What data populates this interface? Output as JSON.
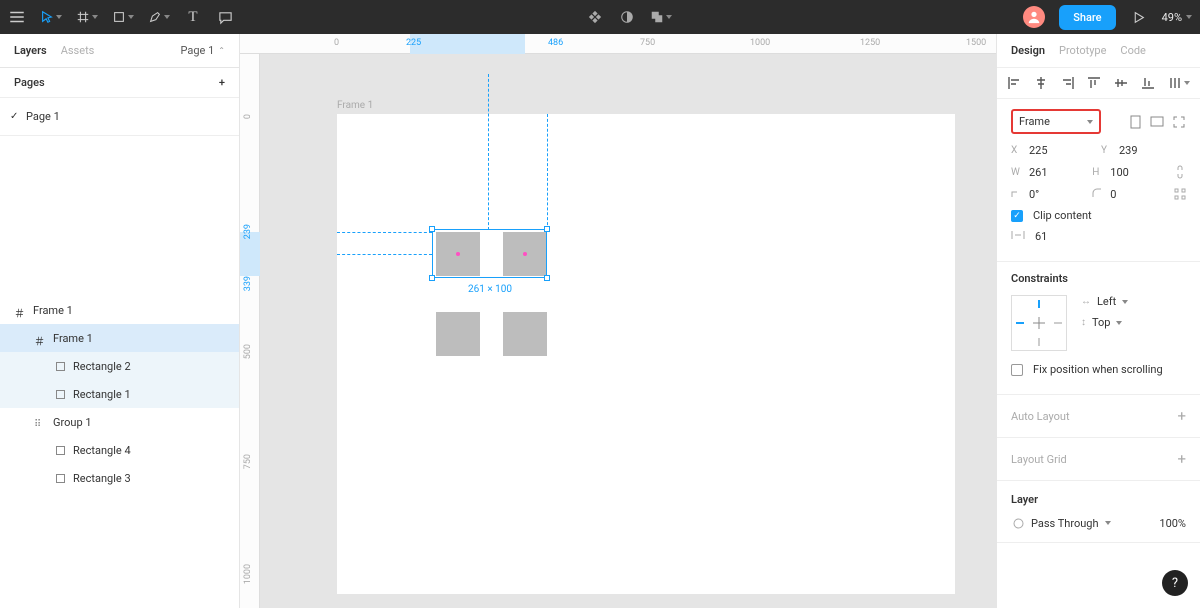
{
  "toolbar": {
    "share_label": "Share",
    "zoom": "49%"
  },
  "left_panel": {
    "tabs": {
      "layers": "Layers",
      "assets": "Assets"
    },
    "page_label": "Page 1",
    "pages_heading": "Pages",
    "pages": [
      "Page 1"
    ],
    "layers": [
      {
        "name": "Frame 1",
        "type": "frame",
        "depth": 0,
        "state": "root"
      },
      {
        "name": "Frame 1",
        "type": "frame",
        "depth": 1,
        "state": "selected"
      },
      {
        "name": "Rectangle 2",
        "type": "rect",
        "depth": 2,
        "state": "child"
      },
      {
        "name": "Rectangle 1",
        "type": "rect",
        "depth": 2,
        "state": "child"
      },
      {
        "name": "Group 1",
        "type": "group",
        "depth": 1,
        "state": ""
      },
      {
        "name": "Rectangle 4",
        "type": "rect",
        "depth": 2,
        "state": ""
      },
      {
        "name": "Rectangle 3",
        "type": "rect",
        "depth": 2,
        "state": ""
      }
    ]
  },
  "canvas": {
    "ruler_top_ticks": [
      "0",
      "750",
      "1000",
      "1250",
      "1500"
    ],
    "ruler_top_sel": [
      "225",
      "486"
    ],
    "ruler_left_ticks": [
      "0",
      "500",
      "750",
      "1000"
    ],
    "ruler_left_sel": [
      "239",
      "339"
    ],
    "frame_label": "Frame 1",
    "selection_dim": "261 × 100"
  },
  "right_panel": {
    "tabs": {
      "design": "Design",
      "prototype": "Prototype",
      "code": "Code"
    },
    "frame_selector": "Frame",
    "x_label": "X",
    "x": "225",
    "y_label": "Y",
    "y": "239",
    "w_label": "W",
    "w": "261",
    "h_label": "H",
    "h": "100",
    "rotation": "0°",
    "radius": "0",
    "clip_label": "Clip content",
    "gap_value": "61",
    "constraints_title": "Constraints",
    "constraint_h": "Left",
    "constraint_v": "Top",
    "fix_label": "Fix position when scrolling",
    "auto_layout": "Auto Layout",
    "layout_grid": "Layout Grid",
    "layer_title": "Layer",
    "blend_mode": "Pass Through",
    "opacity": "100%"
  },
  "help": "?"
}
